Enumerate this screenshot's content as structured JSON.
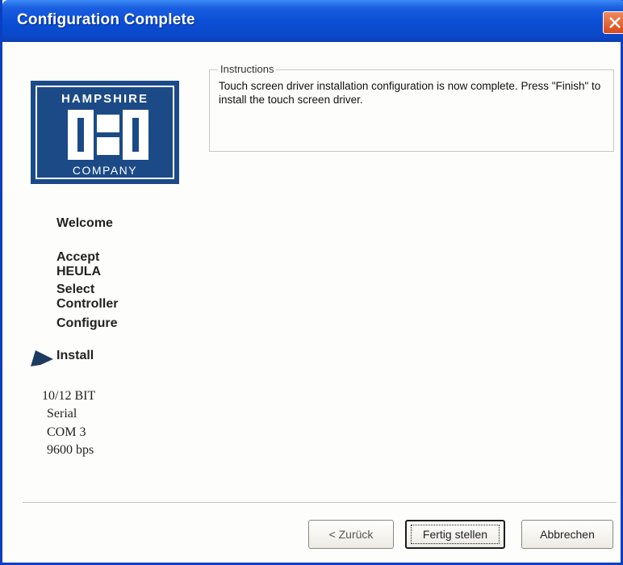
{
  "window": {
    "title": "Configuration Complete"
  },
  "logo": {
    "top": "HAMPSHIRE",
    "bottom": "COMPANY"
  },
  "steps": [
    "Welcome",
    "Accept HEULA",
    "Select Controller",
    "Configure",
    "Install"
  ],
  "current_step": "Install",
  "info": [
    "10/12 BIT",
    "Serial",
    "COM 3",
    "9600 bps"
  ],
  "instructions": {
    "legend": "Instructions",
    "text": "Touch screen driver installation configuration is now complete.  Press \"Finish\" to install the touch screen driver."
  },
  "buttons": {
    "back": "< Zurück",
    "finish": "Fertig stellen",
    "cancel": "Abbrechen"
  },
  "colors": {
    "titlebar": "#0b4fd6",
    "logo_bg": "#1b4a86",
    "close": "#d5491c"
  }
}
